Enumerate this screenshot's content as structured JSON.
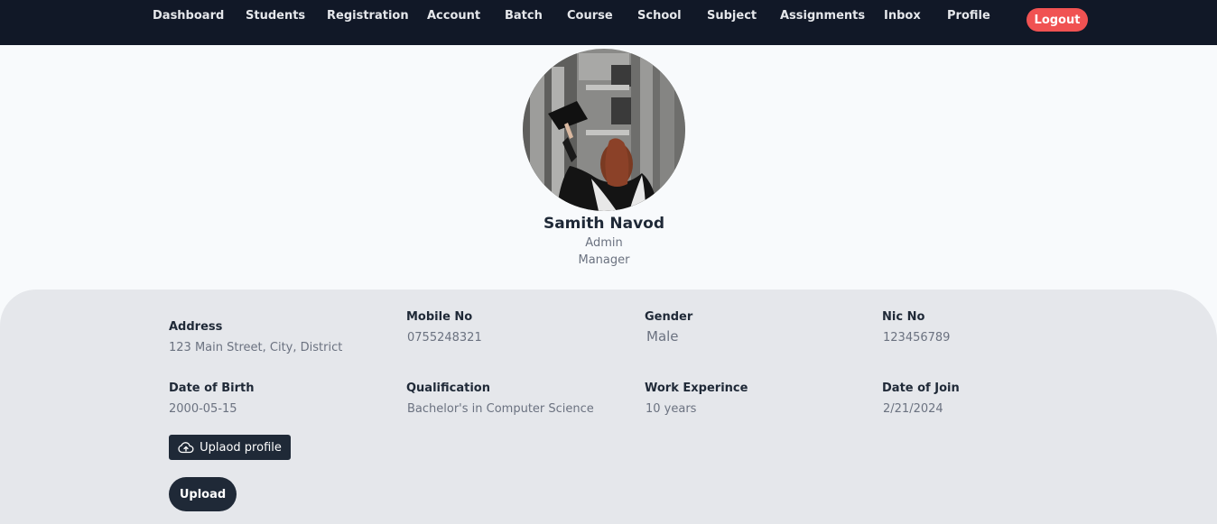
{
  "nav": {
    "items": [
      "Dashboard",
      "Students",
      "Registration",
      "Account",
      "Batch",
      "Course",
      "School",
      "Subject",
      "Assignments",
      "Inbox",
      "Profile"
    ],
    "logout_label": "Logout"
  },
  "profile": {
    "name": "Samith Navod",
    "role": "Admin",
    "position": "Manager"
  },
  "details": {
    "address_label": "Address",
    "address_value": "123 Main Street, City, District",
    "mobile_label": "Mobile No",
    "mobile_value": "0755248321",
    "gender_label": "Gender",
    "gender_value": "Male",
    "nic_label": "Nic No",
    "nic_value": "123456789",
    "dob_label": "Date of Birth",
    "dob_value": "2000-05-15",
    "qualification_label": "Qualification",
    "qualification_value": "Bachelor's in Computer Science",
    "experience_label": "Work Experince",
    "experience_value": "10 years",
    "join_label": "Date of Join",
    "join_value": "2/21/2024"
  },
  "actions": {
    "upload_profile_label": "Uplaod profile",
    "upload_profile_icon": "cloud-upload-icon",
    "upload_label": "Upload"
  },
  "colors": {
    "navbar": "#111827",
    "logout": "#f05252",
    "panel": "#e5e7eb",
    "button": "#1f2937"
  }
}
